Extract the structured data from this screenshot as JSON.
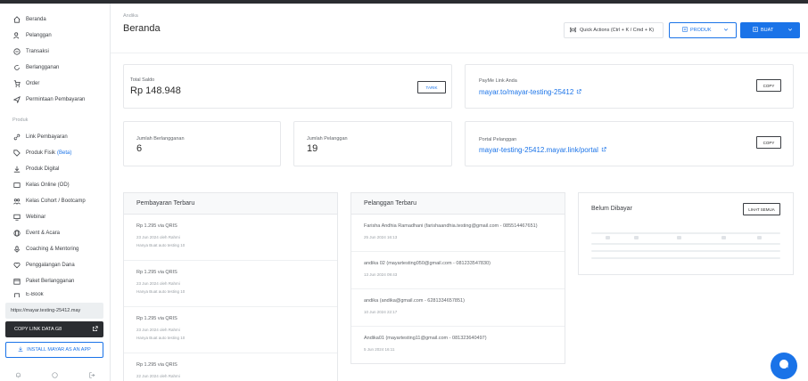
{
  "sidebar": {
    "items": [
      {
        "label": "Beranda",
        "icon": "home-icon"
      },
      {
        "label": "Pelanggan",
        "icon": "users-icon"
      },
      {
        "label": "Transaksi",
        "icon": "transaction-icon"
      },
      {
        "label": "Berlangganan",
        "icon": "refresh-icon"
      },
      {
        "label": "Order",
        "icon": "cart-icon"
      },
      {
        "label": "Permintaan Pembayaran",
        "icon": "send-icon"
      }
    ],
    "section_label": "Produk",
    "product_items": [
      {
        "label": "Link Pembayaran",
        "icon": "link-icon"
      },
      {
        "label": "Produk Fisik",
        "badge": "(Beta)",
        "icon": "tag-icon"
      },
      {
        "label": "Produk Digital",
        "icon": "download-icon"
      },
      {
        "label": "Kelas Online (OD)",
        "icon": "video-icon"
      },
      {
        "label": "Kelas Cohort / Bootcamp",
        "icon": "group-icon"
      },
      {
        "label": "Webinar",
        "icon": "monitor-icon"
      },
      {
        "label": "Event & Acara",
        "icon": "globe-icon"
      },
      {
        "label": "Coaching & Mentoring",
        "icon": "mic-icon"
      },
      {
        "label": "Penggalangan Dana",
        "icon": "heart-icon"
      },
      {
        "label": "Paket Berlangganan",
        "icon": "calendar-icon"
      },
      {
        "label": "E-Book",
        "icon": "book-icon"
      }
    ],
    "url": "https://mayar.testing-25412.may",
    "copy_link_label": "COPY LINK DATA G8",
    "install_label": "INSTALL MAYAR AS AN APP"
  },
  "header": {
    "breadcrumb": "Andika",
    "title": "Beranda",
    "quick_actions_label": "Quick Actions (Ctrl + K / Cmd + K)",
    "produk_label": "PRODUK",
    "buat_label": "BUAT"
  },
  "cards": {
    "total_saldo_label": "Total Saldo",
    "total_saldo_value": "Rp 148.948",
    "tarik_label": "TARIK",
    "paylink_label": "PayMe Link Anda",
    "paylink_url": "mayar.to/mayar-testing-25412",
    "copy_label_1": "COPY",
    "langganan_label": "Jumlah Berlangganan",
    "langganan_value": "6",
    "pelanggan_label": "Jumlah Pelanggan",
    "pelanggan_value": "19",
    "portal_label": "Portal Pelanggan",
    "portal_url": "mayar-testing-25412.mayar.link/portal",
    "copy_label_2": "COPY"
  },
  "payments": {
    "title": "Pembayaran Terbaru",
    "items": [
      {
        "amount": "Rp 1.295 via QRIS",
        "date": "23 Jun 2024 oleh Rahmi",
        "desc": "Hanya Buat auto testing 10"
      },
      {
        "amount": "Rp 1.295 via QRIS",
        "date": "23 Jun 2024 oleh Rahmi",
        "desc": "Hanya Buat auto testing 10"
      },
      {
        "amount": "Rp 1.295 via QRIS",
        "date": "23 Jun 2024 oleh Rahmi",
        "desc": "Hanya Buat auto testing 10"
      },
      {
        "amount": "Rp 1.295 via QRIS",
        "date": "22 Jun 2024 oleh Rahmi",
        "desc": ""
      }
    ]
  },
  "customers": {
    "title": "Pelanggan Terbaru",
    "items": [
      {
        "name": "Farisha Andhia Ramadhani (farishaandhia.testing@gmail.com - 085514467651)",
        "date": "25 Jun 2024 16:13"
      },
      {
        "name": "andika 02 (mayartesting050@gmail.com - 081233547830)",
        "date": "13 Jun 2024 09:43"
      },
      {
        "name": "andika (andika@gmail.com - 6281334657851)",
        "date": "10 Jun 2024 22:17"
      },
      {
        "name": "Andika01 (mayartesting11@gmail.com - 081323640497)",
        "date": "5 Jun 2024 16:11"
      }
    ]
  },
  "unpaid": {
    "title": "Belum Dibayar",
    "button_label": "LIHAT SEMUA"
  }
}
